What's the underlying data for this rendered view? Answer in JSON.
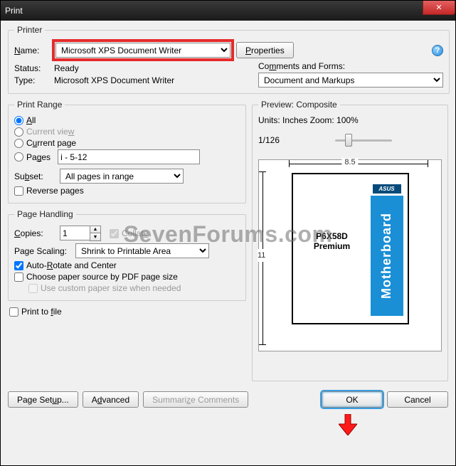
{
  "window": {
    "title": "Print"
  },
  "controls": {
    "close_glyph": "✕",
    "help_glyph": "?"
  },
  "printer": {
    "legend": "Printer",
    "name_label": "Name:",
    "name_value": "Microsoft XPS Document Writer",
    "properties_btn": "Properties",
    "status_label": "Status:",
    "status_value": "Ready",
    "type_label": "Type:",
    "type_value": "Microsoft XPS Document Writer",
    "comments_label": "Comments and Forms:",
    "comments_value": "Document and Markups"
  },
  "range": {
    "legend": "Print Range",
    "all": "All",
    "current_view": "Current view",
    "current_page": "Current page",
    "pages": "Pages",
    "pages_value": "i - 5-12",
    "subset_label": "Subset:",
    "subset_value": "All pages in range",
    "reverse": "Reverse pages"
  },
  "handling": {
    "legend": "Page Handling",
    "copies_label": "Copies:",
    "copies_value": "1",
    "collate": "Collate",
    "scaling_label": "Page Scaling:",
    "scaling_value": "Shrink to Printable Area",
    "auto_rotate": "Auto-Rotate and Center",
    "choose_source": "Choose paper source by PDF page size",
    "use_custom": "Use custom paper size when needed"
  },
  "print_to_file": "Print to file",
  "preview": {
    "legend": "Preview: Composite",
    "units_label": "Units: Inches Zoom: 100%",
    "page_count": "1/126",
    "width_label": "8.5",
    "height_label": "11",
    "doc_title1": "P6X58D",
    "doc_title2": "Premium",
    "band_text": "Motherboard",
    "asus": "ASUS"
  },
  "footer": {
    "page_setup": "Page Setup...",
    "advanced": "Advanced",
    "summarize": "Summarize Comments",
    "ok": "OK",
    "cancel": "Cancel"
  },
  "watermark": "SevenForums.com"
}
